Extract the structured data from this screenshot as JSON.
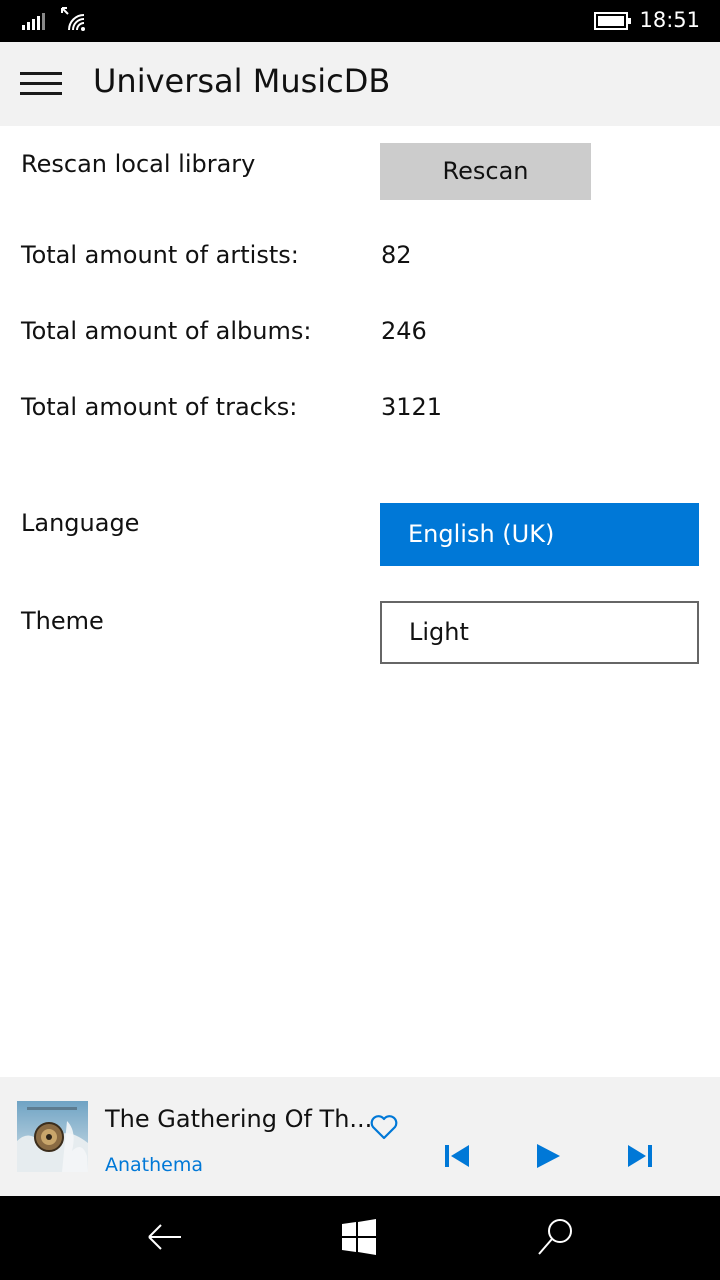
{
  "status_bar": {
    "time": "18:51",
    "icons": [
      "signal-icon",
      "wifi-icon",
      "battery-icon"
    ]
  },
  "header": {
    "title": "Universal MusicDB",
    "menu_icon": "hamburger-menu-icon"
  },
  "settings": {
    "rescan": {
      "label": "Rescan local library",
      "button": "Rescan"
    },
    "stats": [
      {
        "label": "Total amount of artists:",
        "value": "82"
      },
      {
        "label": "Total amount of albums:",
        "value": "246"
      },
      {
        "label": "Total amount of tracks:",
        "value": "3121"
      }
    ],
    "language": {
      "label": "Language",
      "selected": "English (UK)"
    },
    "theme": {
      "label": "Theme",
      "selected": "Light"
    }
  },
  "now_playing": {
    "title": "The Gathering Of Th...",
    "artist": "Anathema",
    "controls": [
      "favorite-heart-icon",
      "previous-track-icon",
      "play-icon",
      "next-track-icon"
    ]
  },
  "nav_bar": {
    "icons": [
      "back-arrow-icon",
      "windows-start-icon",
      "search-icon"
    ]
  },
  "colors": {
    "accent": "#0078d7",
    "header_bg": "#f2f2f2",
    "button_bg": "#cccccc",
    "system_bar": "#000000"
  }
}
